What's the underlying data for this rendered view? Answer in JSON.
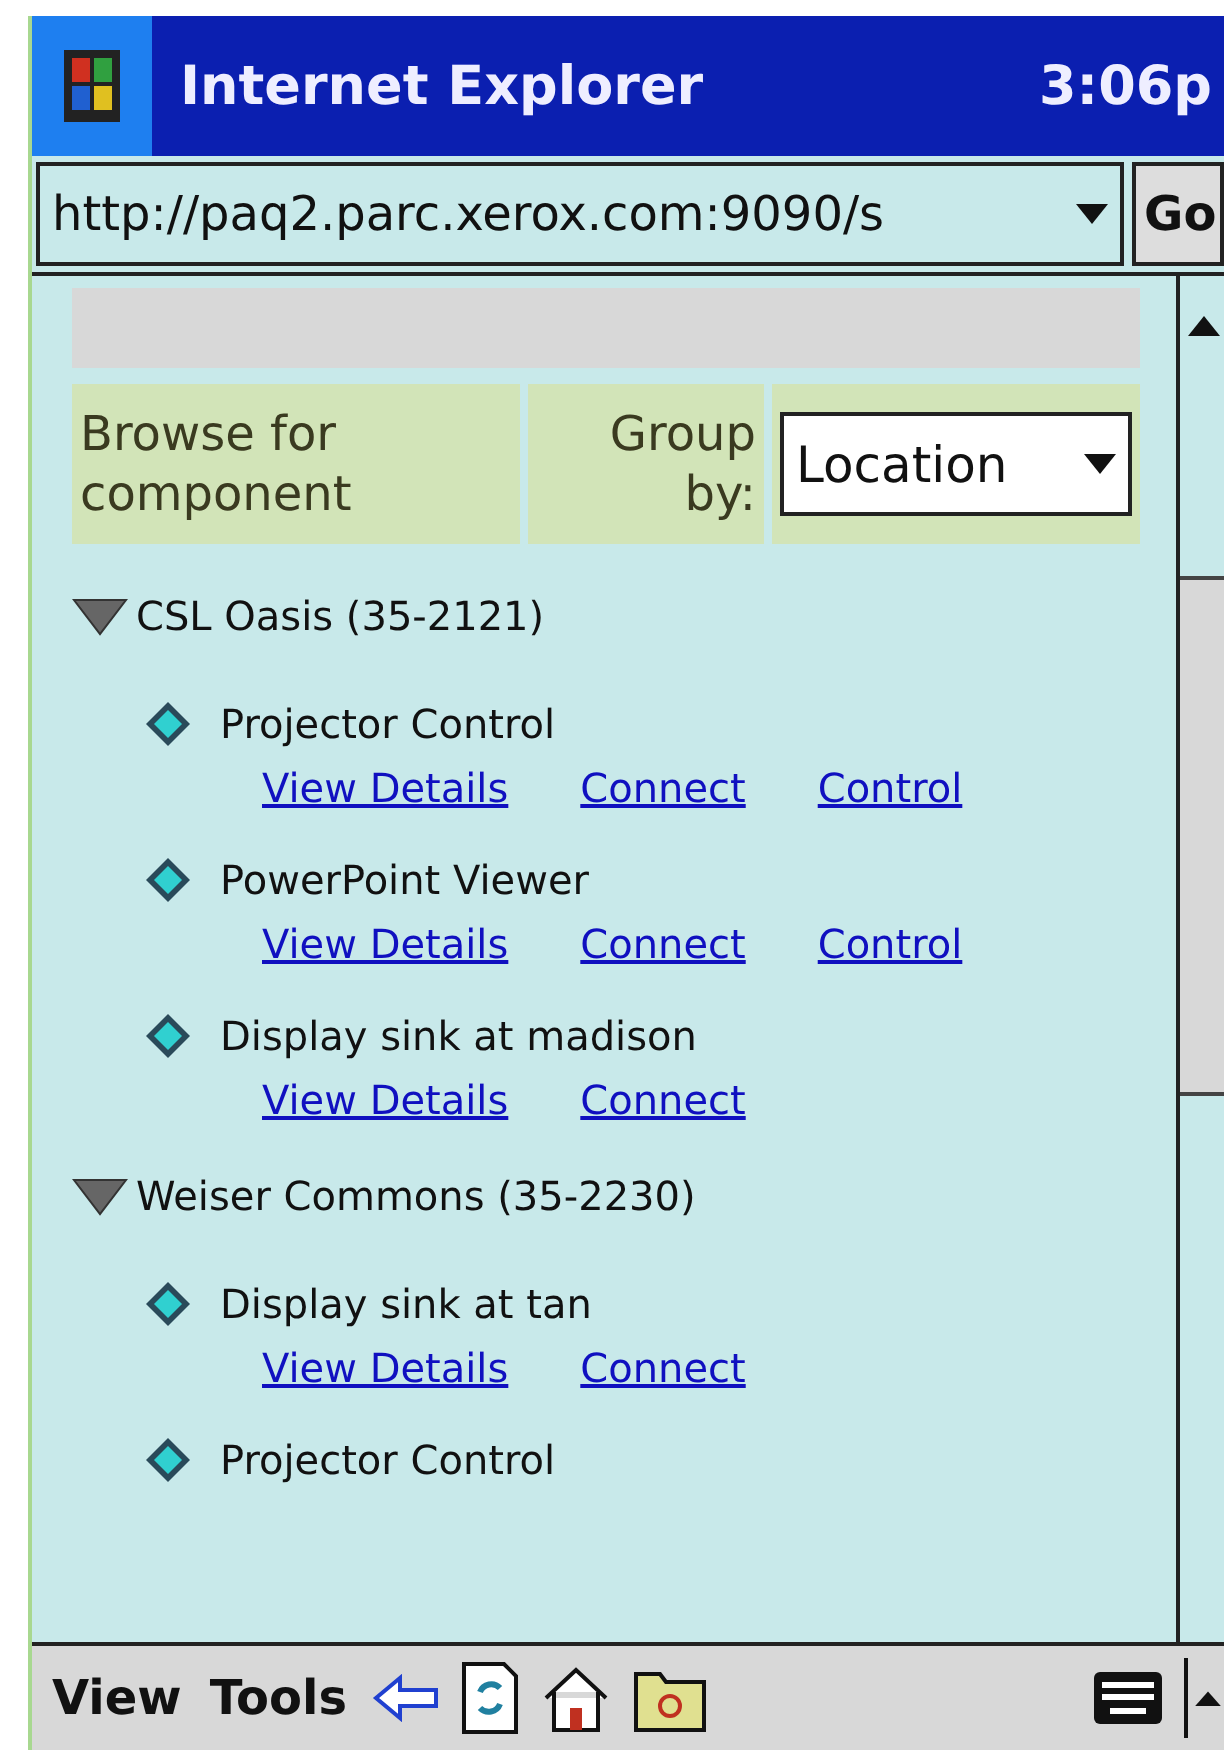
{
  "window": {
    "title": "Internet Explorer",
    "time": "3:06p"
  },
  "address_bar": {
    "value": "http://paq2.parc.xerox.com:9090/s",
    "go": "Go"
  },
  "browse_header": {
    "label": "Browse for component",
    "group_label": "Group by:",
    "group_value": "Location"
  },
  "groups": [
    {
      "name": "CSL Oasis (35-2121)",
      "expanded": true,
      "items": [
        {
          "name": "Projector Control",
          "links": [
            "View Details",
            "Connect",
            "Control"
          ]
        },
        {
          "name": "PowerPoint Viewer",
          "links": [
            "View Details",
            "Connect",
            "Control"
          ]
        },
        {
          "name": "Display sink at madison",
          "links": [
            "View Details",
            "Connect"
          ]
        }
      ]
    },
    {
      "name": "Weiser Commons (35-2230)",
      "expanded": true,
      "items": [
        {
          "name": "Display sink at tan",
          "links": [
            "View Details",
            "Connect"
          ]
        },
        {
          "name": "Projector Control"
        }
      ]
    }
  ],
  "menu_bar": [
    "View",
    "Tools"
  ]
}
